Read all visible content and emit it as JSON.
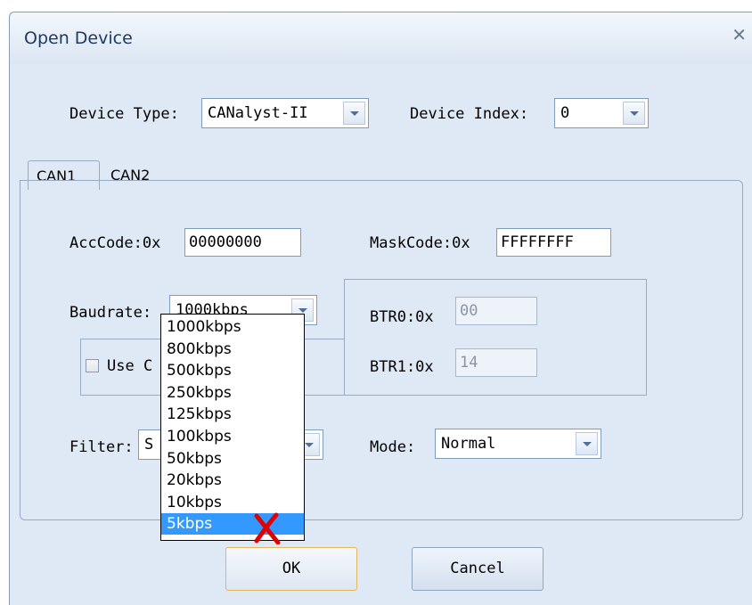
{
  "window": {
    "title": "Open Device"
  },
  "device": {
    "type_label": "Device Type:",
    "type_value": "CANalyst-II",
    "index_label": "Device Index:",
    "index_value": "0"
  },
  "tabs": [
    {
      "label": "CAN1",
      "active": true
    },
    {
      "label": "CAN2",
      "active": false
    }
  ],
  "can": {
    "acc_label": "AccCode:0x",
    "acc_value": "00000000",
    "mask_label": "MaskCode:0x",
    "mask_value": "FFFFFFFF",
    "baud_label": "Baudrate:",
    "baud_value": "1000kbps",
    "btr0_label": "BTR0:0x",
    "btr0_value": "00",
    "btr1_label": "BTR1:0x",
    "btr1_value": "14",
    "usecustom_label": "Use C",
    "filter_label": "Filter:",
    "filter_value": "S",
    "mode_label": "Mode:",
    "mode_value": "Normal"
  },
  "baud_options": [
    "1000kbps",
    "800kbps",
    "500kbps",
    "250kbps",
    "125kbps",
    "100kbps",
    "50kbps",
    "20kbps",
    "10kbps",
    "5kbps"
  ],
  "baud_selected_index": 9,
  "buttons": {
    "ok": "OK",
    "cancel": "Cancel"
  },
  "colors": {
    "highlight": "#3399ff",
    "annotation": "#e00000"
  }
}
